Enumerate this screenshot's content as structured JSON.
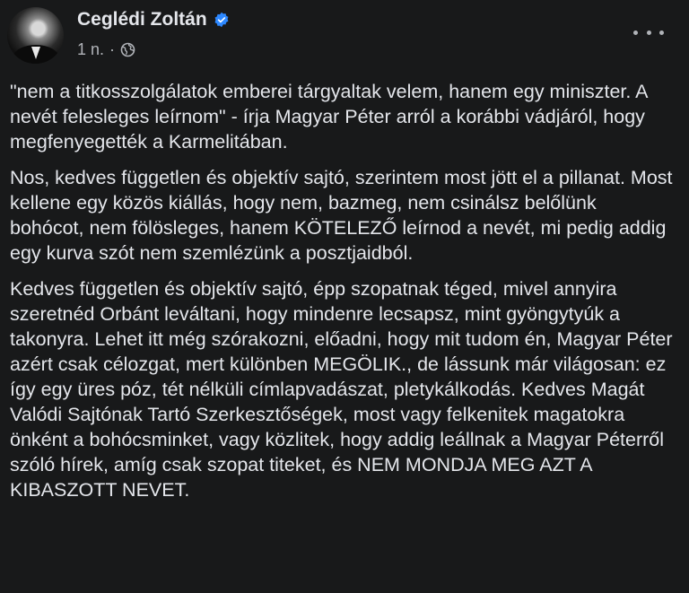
{
  "post": {
    "author": "Ceglédi Zoltán",
    "timestamp": "1 n.",
    "separator": "·",
    "audience_icon": "globe-icon",
    "verified_icon": "verified-badge-icon",
    "more_icon": "more-options-icon",
    "paragraphs": [
      "\"nem a titkosszolgálatok emberei tárgyaltak velem, hanem egy miniszter. A nevét felesleges leírnom\" - írja Magyar Péter arról a korábbi vádjáról, hogy megfenyegették a Karmelitában.",
      "Nos, kedves független és objektív sajtó, szerintem most jött el a pillanat. Most kellene egy közös kiállás, hogy nem, bazmeg, nem csinálsz belőlünk bohócot, nem fölösleges, hanem KÖTELEZŐ leírnod a nevét, mi pedig addig egy kurva szót nem szemlézünk a posztjaidból.",
      "Kedves független és objektív sajtó, épp szopatnak téged, mivel annyira szeretnéd Orbánt leváltani, hogy mindenre lecsapsz, mint gyöngytyúk a takonyra. Lehet itt még szórakozni, előadni, hogy mit tudom én, Magyar Péter azért csak célozgat, mert különben MEGÖLIK., de lássunk már világosan: ez így egy üres póz, tét nélküli címlapvadászat, pletykálkodás. Kedves Magát Valódi Sajtónak Tartó Szerkesztőségek, most vagy felkenitek magatokra önként a bohócsminket, vagy közlitek, hogy addig leállnak a Magyar Péterről szóló hírek, amíg csak szopat titeket, és NEM MONDJA MEG AZT A KIBASZOTT NEVET."
    ]
  },
  "colors": {
    "background": "#18191a",
    "primary_text": "#e4e6eb",
    "secondary_text": "#b0b3b8",
    "verified_blue": "#2d88ff"
  }
}
